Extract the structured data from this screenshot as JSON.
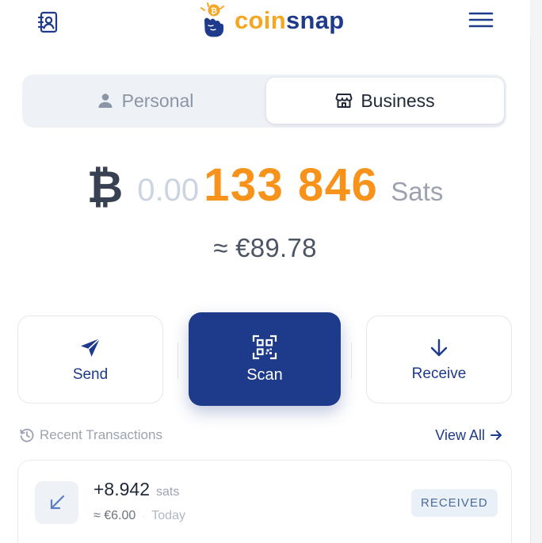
{
  "header": {
    "logo_text_part1": "coin",
    "logo_text_part2": "snap",
    "contacts_icon": "address-book-icon",
    "menu_icon": "hamburger-menu-icon",
    "logo_badge_symbol": "₿"
  },
  "account_toggle": {
    "options": [
      {
        "label": "Personal",
        "icon": "person-icon",
        "selected": false
      },
      {
        "label": "Business",
        "icon": "store-icon",
        "selected": true
      }
    ]
  },
  "balance": {
    "currency_symbol": "₿",
    "dim_prefix": "0.00",
    "sats_amount": "133 846",
    "unit": "Sats",
    "fiat_equivalent": "≈ €89.78",
    "accent_color": "#f7931a"
  },
  "actions": {
    "send": {
      "label": "Send",
      "icon": "paper-plane-icon"
    },
    "scan": {
      "label": "Scan",
      "icon": "qr-code-icon"
    },
    "receive": {
      "label": "Receive",
      "icon": "arrow-down-icon"
    }
  },
  "recent": {
    "title": "Recent Transactions",
    "title_icon": "history-icon",
    "view_all_label": "View All",
    "view_all_icon": "arrow-right-icon",
    "transactions": [
      {
        "amount": "+8.942",
        "unit": "sats",
        "fiat": "≈ €6.00",
        "separator": "·",
        "date": "Today",
        "status": "RECEIVED",
        "icon": "arrow-down-left-icon"
      }
    ]
  },
  "colors": {
    "primary": "#1e3a8a",
    "accent": "#f7931a",
    "muted": "#9ca3af"
  }
}
